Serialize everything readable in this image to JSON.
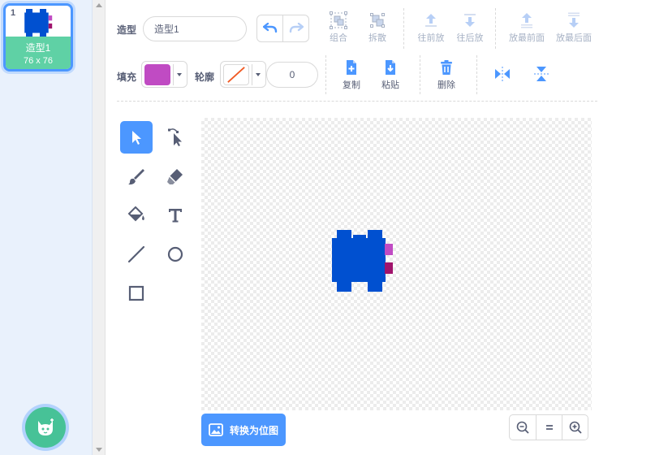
{
  "costumes": {
    "items": [
      {
        "index": "1",
        "name": "造型1",
        "size": "76 x 76"
      }
    ]
  },
  "costume_panel": {
    "name_label": "造型",
    "name_value": "造型1",
    "fill_label": "填充",
    "outline_label": "轮廓",
    "outline_width": "0",
    "fill_color": "#c04bc3"
  },
  "toolbar": {
    "group": "组合",
    "ungroup": "拆散",
    "forward": "往前放",
    "backward": "往后放",
    "front": "放最前面",
    "back": "放最后面",
    "copy": "复制",
    "paste": "粘贴",
    "delete": "删除"
  },
  "canvas": {
    "convert_bitmap": "转换为位图"
  },
  "colors": {
    "accent": "#4c97ff",
    "sprite_blue": "#0050d0",
    "sprite_pink": "#c04bc3",
    "sprite_magenta": "#a0146c",
    "costume_label_bg": "#5fd1a5",
    "add_button": "#47c297"
  }
}
